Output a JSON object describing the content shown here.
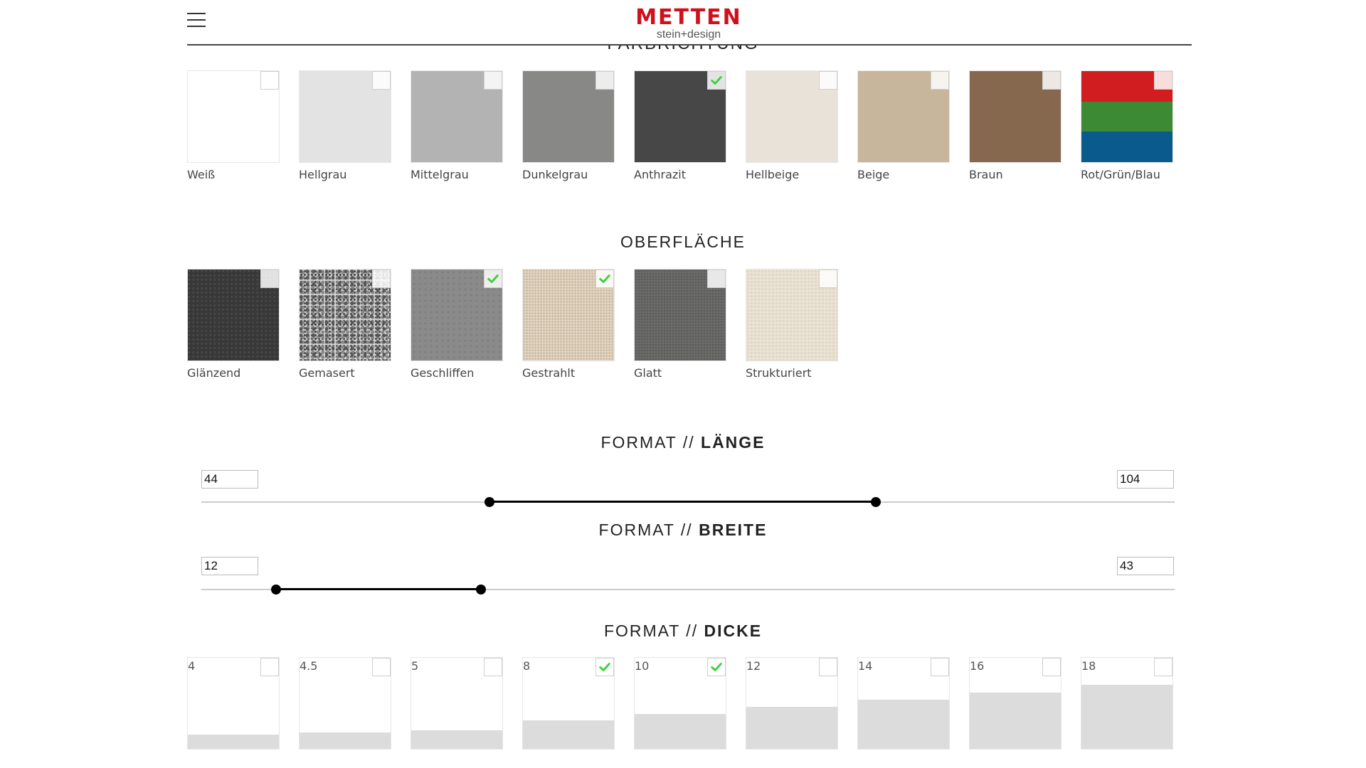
{
  "header": {
    "logo_mark": "METTEN",
    "logo_sub": "stein+design",
    "clipped_heading": "FARBRICHTUNG"
  },
  "colors": [
    {
      "label": "Weiß",
      "color": "#ffffff",
      "checked": false
    },
    {
      "label": "Hellgrau",
      "color": "#e3e3e3",
      "checked": false
    },
    {
      "label": "Mittelgrau",
      "color": "#b3b3b3",
      "checked": false
    },
    {
      "label": "Dunkelgrau",
      "color": "#888887",
      "checked": false
    },
    {
      "label": "Anthrazit",
      "color": "#474747",
      "checked": true
    },
    {
      "label": "Hellbeige",
      "color": "#e9e2d8",
      "checked": false
    },
    {
      "label": "Beige",
      "color": "#c8b69c",
      "checked": false
    },
    {
      "label": "Braun",
      "color": "#86684e",
      "checked": false
    },
    {
      "label": "Rot/Grün/Blau",
      "stripes": [
        "#d11d20",
        "#3c8a34",
        "#0a5b8c"
      ],
      "checked": false
    }
  ],
  "surface": {
    "title": "OBERFLÄCHE",
    "items": [
      {
        "label": "Glänzend",
        "texture": "glaenzend",
        "checked": false
      },
      {
        "label": "Gemasert",
        "texture": "gemasert",
        "checked": false
      },
      {
        "label": "Geschliffen",
        "texture": "geschliffen",
        "checked": true
      },
      {
        "label": "Gestrahlt",
        "texture": "gestrahlt",
        "checked": true
      },
      {
        "label": "Glatt",
        "texture": "glatt",
        "checked": false
      },
      {
        "label": "Strukturiert",
        "texture": "strukturiert",
        "checked": false
      }
    ]
  },
  "length": {
    "title_prefix": "FORMAT //",
    "title_bold": "LÄNGE",
    "min_value": "44",
    "max_value": "104",
    "range_start_pct": 29.6,
    "range_end_pct": 69.3
  },
  "width": {
    "title_prefix": "FORMAT //",
    "title_bold": "BREITE",
    "min_value": "12",
    "max_value": "43",
    "range_start_pct": 7.7,
    "range_end_pct": 28.7
  },
  "thickness": {
    "title_prefix": "FORMAT //",
    "title_bold": "DICKE",
    "items": [
      {
        "label": "4",
        "fill_pct": 16,
        "checked": false
      },
      {
        "label": "4.5",
        "fill_pct": 18,
        "checked": false
      },
      {
        "label": "5",
        "fill_pct": 20,
        "checked": false
      },
      {
        "label": "8",
        "fill_pct": 31,
        "checked": true
      },
      {
        "label": "10",
        "fill_pct": 38,
        "checked": true
      },
      {
        "label": "12",
        "fill_pct": 46,
        "checked": false
      },
      {
        "label": "14",
        "fill_pct": 54,
        "checked": false
      },
      {
        "label": "16",
        "fill_pct": 62,
        "checked": false
      },
      {
        "label": "18",
        "fill_pct": 70,
        "checked": false
      }
    ]
  },
  "accent": {
    "check": "#3fd03f",
    "logo": "#d0101c"
  }
}
